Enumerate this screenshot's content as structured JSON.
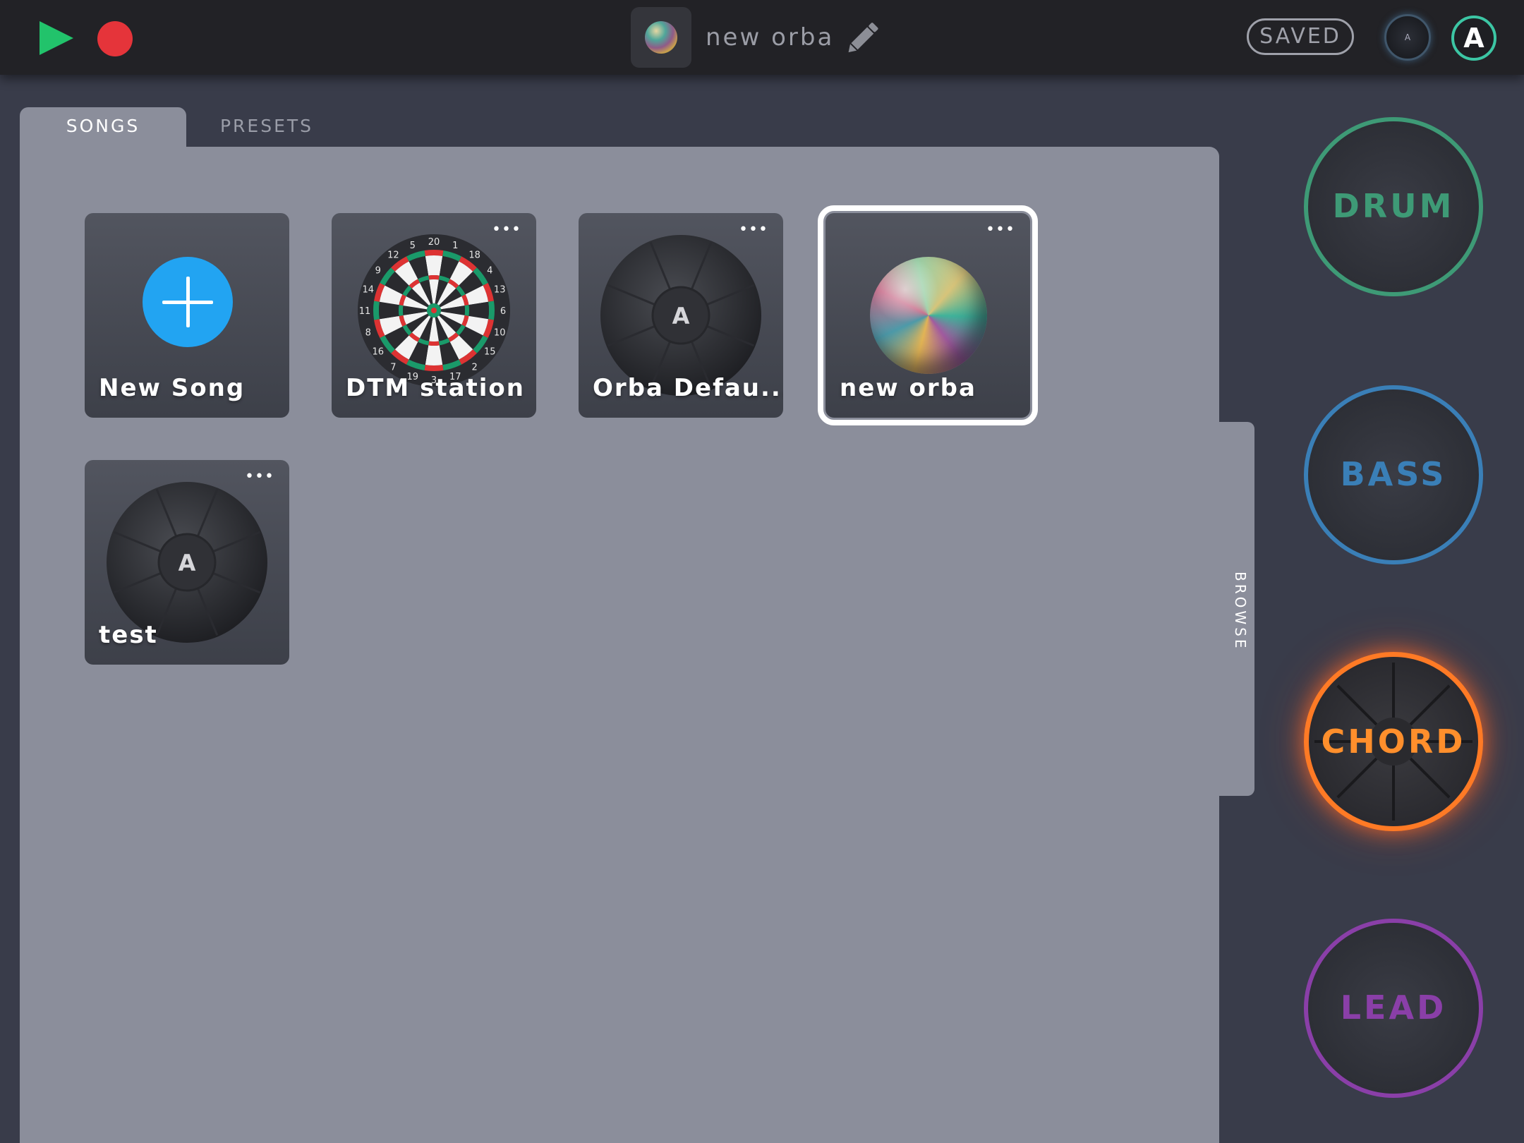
{
  "header": {
    "song_title": "new orba",
    "saved_label": "SAVED",
    "account_letter": "A",
    "device_letter": "A"
  },
  "tabs": [
    {
      "label": "SONGS",
      "active": true
    },
    {
      "label": "PRESETS",
      "active": false
    }
  ],
  "browse_label": "BROWSE",
  "songs": [
    {
      "name": "New Song",
      "kind": "new"
    },
    {
      "name": "DTM station",
      "kind": "dartboard"
    },
    {
      "name": "Orba Defau...",
      "kind": "orba"
    },
    {
      "name": "new orba",
      "kind": "marble",
      "selected": true
    },
    {
      "name": "test",
      "kind": "orba"
    }
  ],
  "card_menu_glyph": "•••",
  "dartboard_numbers": [
    "20",
    "1",
    "18",
    "4",
    "13",
    "6",
    "10",
    "15",
    "2",
    "17",
    "3",
    "19",
    "7",
    "16",
    "8",
    "11",
    "14",
    "9",
    "12",
    "5"
  ],
  "instruments": [
    {
      "label": "DRUM",
      "color": "#3e9a76"
    },
    {
      "label": "BASS",
      "color": "#3a7fb7"
    },
    {
      "label": "CHORD",
      "color": "#ff7a25",
      "active": true
    },
    {
      "label": "LEAD",
      "color": "#8a3fa8"
    }
  ],
  "colors": {
    "play": "#22c36b",
    "record": "#e5343a",
    "add_button": "#22a4f2",
    "panel": "#8b8e9b"
  }
}
